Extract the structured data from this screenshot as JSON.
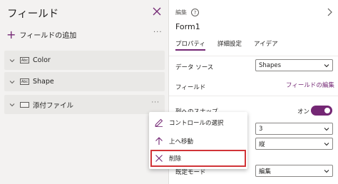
{
  "fields_pane": {
    "title": "フィールド",
    "add_field_label": "フィールドの追加",
    "more": "···",
    "fields": [
      {
        "name": "Color",
        "type_badge": "Abc",
        "more": ""
      },
      {
        "name": "Shape",
        "type_badge": "Abc",
        "more": ""
      },
      {
        "name": "添付ファイル",
        "type_badge": "",
        "more": "···"
      }
    ]
  },
  "properties_pane": {
    "section_label": "編集",
    "help_icon": "?",
    "form_name": "Form1",
    "tabs": [
      "プロパティ",
      "詳細設定",
      "アイデア"
    ],
    "active_tab": "プロパティ",
    "data_source_label": "データ ソース",
    "data_source_value": "Shapes",
    "fields_label": "フィールド",
    "edit_fields_link": "フィールドの編集",
    "snap_label": "列へのスナップ",
    "snap_toggle_label": "オン",
    "columns_value": "3",
    "layout_value": "縦",
    "default_mode_label": "既定モード",
    "default_mode_value": "編集"
  },
  "context_menu": {
    "items": [
      {
        "label": "コントロールの選択",
        "icon": "edit-icon"
      },
      {
        "label": "上へ移動",
        "icon": "arrow-up-icon"
      },
      {
        "label": "削除",
        "icon": "close-icon",
        "highlighted": true
      }
    ]
  },
  "colors": {
    "accent": "#742774",
    "highlight_border": "#d13438"
  }
}
